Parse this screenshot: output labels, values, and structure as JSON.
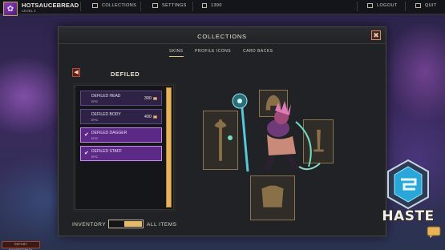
{
  "topbar": {
    "username": "HOTSAUCEBREAD",
    "level": "LEVEL 4",
    "collections": "COLLECTIONS",
    "settings": "SETTINGS",
    "currency": "1390",
    "logout": "LOGOUT",
    "quit": "QUIT"
  },
  "modal": {
    "title": "COLLECTIONS",
    "close": "✖",
    "tabs": [
      {
        "label": "SKINS",
        "active": true
      },
      {
        "label": "PROFILE ICONS",
        "active": false
      },
      {
        "label": "CARD BACKS",
        "active": false
      }
    ],
    "back": "◀",
    "set_name": "DEFILED",
    "items": [
      {
        "name": "DEFILED HEAD",
        "rarity": "EPIC",
        "price": "300",
        "owned": false
      },
      {
        "name": "DEFILED BODY",
        "rarity": "EPIC",
        "price": "400",
        "owned": false
      },
      {
        "name": "DEFILED DAGGER",
        "rarity": "EPIC",
        "price": "",
        "owned": true
      },
      {
        "name": "DEFILED STAFF",
        "rarity": "EPIC",
        "price": "",
        "owned": true
      }
    ],
    "inventory_label": "INVENTORY",
    "all_items_label": "ALL ITEMS",
    "check": "✔"
  },
  "report_button": "REPORT BUG/FEEDBACK",
  "logo": {
    "text": "HASTE"
  },
  "colors": {
    "accent_gold": "#e8b35a",
    "owned_purple": "#5c2a86",
    "unowned_purple": "#2e2247",
    "close_red": "#d98b6a"
  },
  "icons": {
    "collections": "grid-icon",
    "settings": "sliders-icon",
    "currency": "coin-stack-icon",
    "logout": "logout-icon",
    "quit": "power-icon"
  }
}
